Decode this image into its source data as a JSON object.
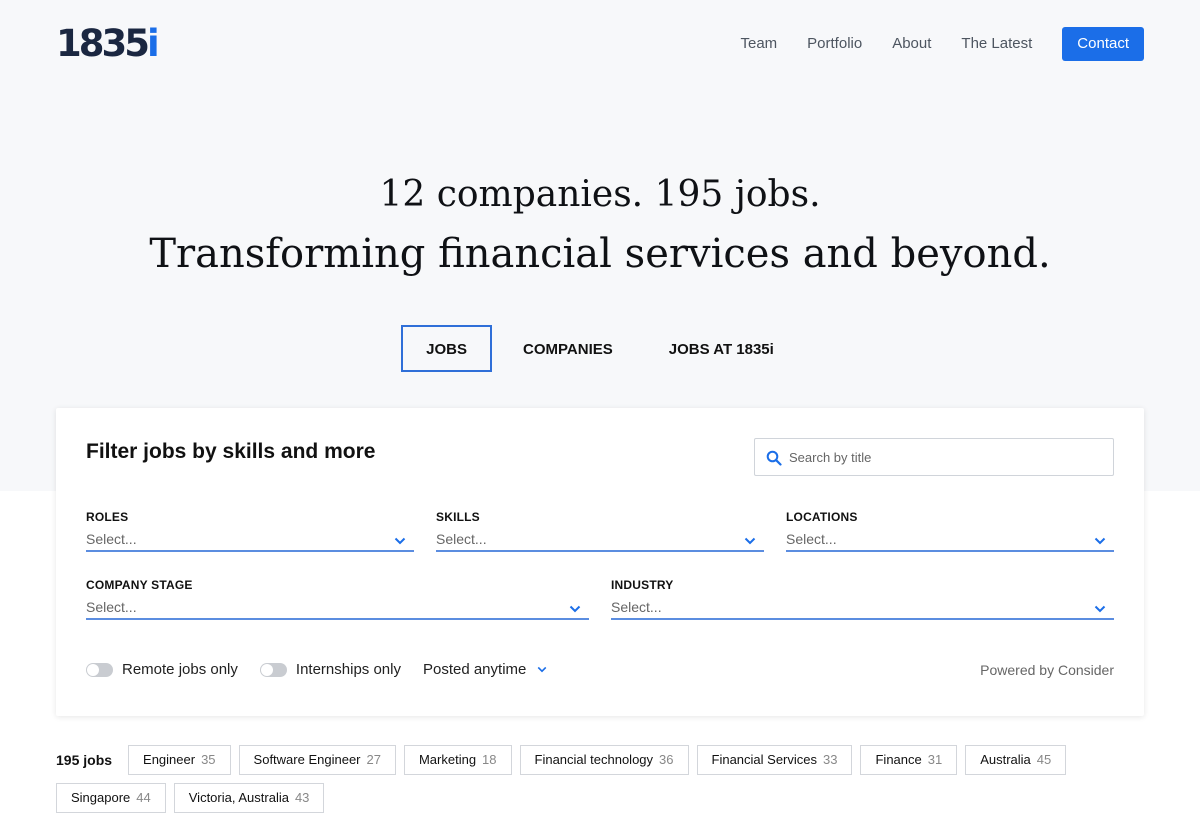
{
  "nav": {
    "logo_main": "1835",
    "logo_accent": "i",
    "links": [
      "Team",
      "Portfolio",
      "About",
      "The Latest"
    ],
    "contact_label": "Contact"
  },
  "hero": {
    "line1": "12 companies. 195 jobs.",
    "line2": "Transforming financial services and beyond."
  },
  "tabs": [
    "JOBS",
    "COMPANIES",
    "JOBS AT 1835i"
  ],
  "filter": {
    "title": "Filter jobs by skills and more",
    "search_placeholder": "Search by title",
    "fields": {
      "roles": {
        "label": "ROLES",
        "value": "Select..."
      },
      "skills": {
        "label": "SKILLS",
        "value": "Select..."
      },
      "locations": {
        "label": "LOCATIONS",
        "value": "Select..."
      },
      "company_stage": {
        "label": "COMPANY STAGE",
        "value": "Select..."
      },
      "industry": {
        "label": "INDUSTRY",
        "value": "Select..."
      }
    },
    "remote_label": "Remote jobs only",
    "internships_label": "Internships only",
    "posted_label": "Posted anytime",
    "powered_by": "Powered by Consider"
  },
  "results": {
    "count_label": "195 jobs",
    "chips": [
      {
        "label": "Engineer",
        "count": "35"
      },
      {
        "label": "Software Engineer",
        "count": "27"
      },
      {
        "label": "Marketing",
        "count": "18"
      },
      {
        "label": "Financial technology",
        "count": "36"
      },
      {
        "label": "Financial Services",
        "count": "33"
      },
      {
        "label": "Finance",
        "count": "31"
      },
      {
        "label": "Australia",
        "count": "45"
      },
      {
        "label": "Singapore",
        "count": "44"
      },
      {
        "label": "Victoria, Australia",
        "count": "43"
      }
    ]
  },
  "colors": {
    "accent": "#1b6ee8",
    "logo_dark": "#1b2741",
    "hero_bg": "#f7f8fa",
    "field_underline": "#5b8de0"
  },
  "icons": {
    "search": "search-icon",
    "chevron": "chevron-down-icon"
  }
}
